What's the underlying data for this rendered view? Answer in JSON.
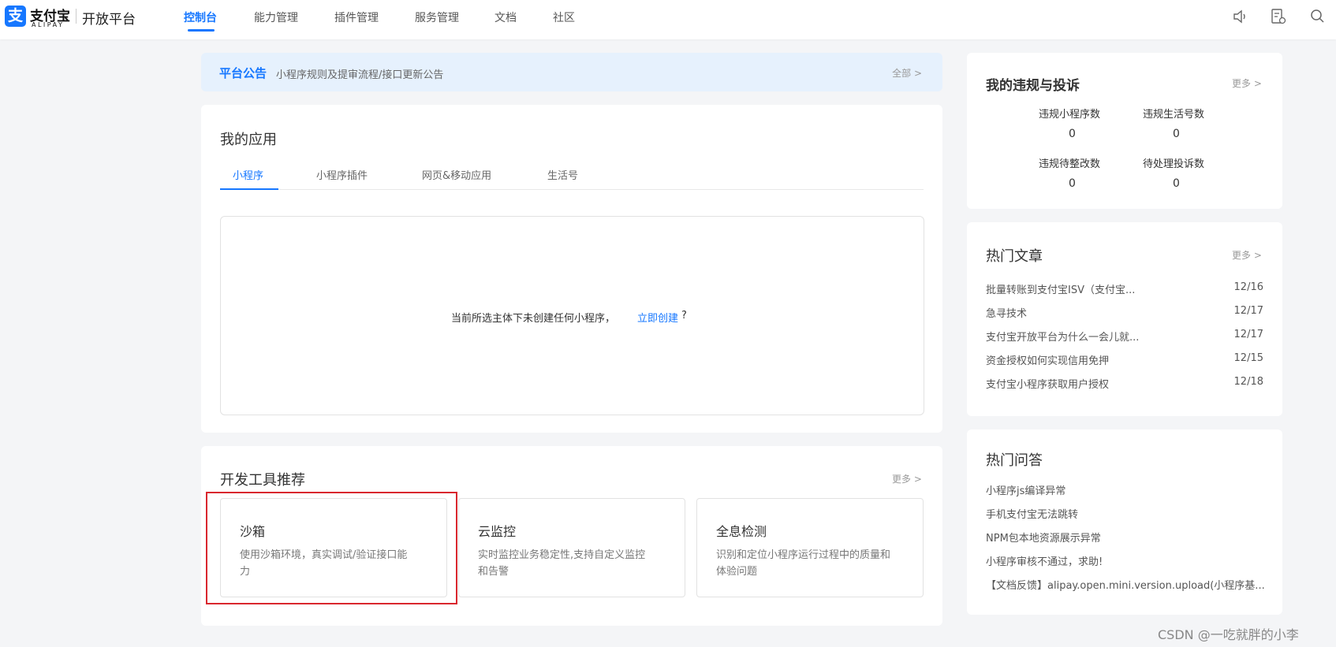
{
  "brand": {
    "logo_glyph": "支",
    "name_cn": "支付宝",
    "name_en": "ALIPAY",
    "platform": "开放平台",
    "accent": "#1677ff"
  },
  "nav": {
    "items": [
      "控制台",
      "能力管理",
      "插件管理",
      "服务管理",
      "文档",
      "社区"
    ],
    "active": "控制台"
  },
  "top_icons": [
    "speaker-icon",
    "document-settings-icon",
    "search-icon"
  ],
  "notice": {
    "title": "平台公告",
    "text": "小程序规则及提审流程/接口更新公告",
    "all": "全部 >"
  },
  "my_apps": {
    "title": "我的应用",
    "tabs": [
      "小程序",
      "小程序插件",
      "网页&移动应用",
      "生活号"
    ],
    "empty_text": "当前所选主体下未创建任何小程序，",
    "create_link": "立即创建",
    "question_mark": "?"
  },
  "tools": {
    "title": "开发工具推荐",
    "more": "更多 >",
    "items": [
      {
        "name": "沙箱",
        "desc_line1": "使用沙箱环境，真实调试/验证接口能",
        "desc_line2": "力"
      },
      {
        "name": "云监控",
        "desc_line1": "实时监控业务稳定性,支持自定义监控",
        "desc_line2": "和告警"
      },
      {
        "name": "全息检测",
        "desc_line1": "识别和定位小程序运行过程中的质量和",
        "desc_line2": "体验问题"
      }
    ]
  },
  "violations": {
    "title": "我的违规与投诉",
    "more": "更多 >",
    "stats": [
      {
        "label": "违规小程序数",
        "value": "0"
      },
      {
        "label": "违规生活号数",
        "value": "0"
      },
      {
        "label": "违规待整改数",
        "value": "0"
      },
      {
        "label": "待处理投诉数",
        "value": "0"
      }
    ]
  },
  "articles": {
    "title": "热门文章",
    "more": "更多 >",
    "items": [
      {
        "title": "批量转账到支付宝ISV（支付宝...",
        "date": "12/16"
      },
      {
        "title": "急寻技术",
        "date": "12/17"
      },
      {
        "title": "支付宝开放平台为什么一会儿就...",
        "date": "12/17"
      },
      {
        "title": "资金授权如何实现信用免押",
        "date": "12/15"
      },
      {
        "title": "支付宝小程序获取用户授权",
        "date": "12/18"
      }
    ]
  },
  "qa": {
    "title": "热门问答",
    "items": [
      "小程序js编译异常",
      "手机支付宝无法跳转",
      "NPM包本地资源展示异常",
      "小程序审核不通过，求助!",
      "【文档反馈】alipay.open.mini.version.upload(小程序基..."
    ]
  },
  "watermark": "CSDN @一吃就胖的小李"
}
